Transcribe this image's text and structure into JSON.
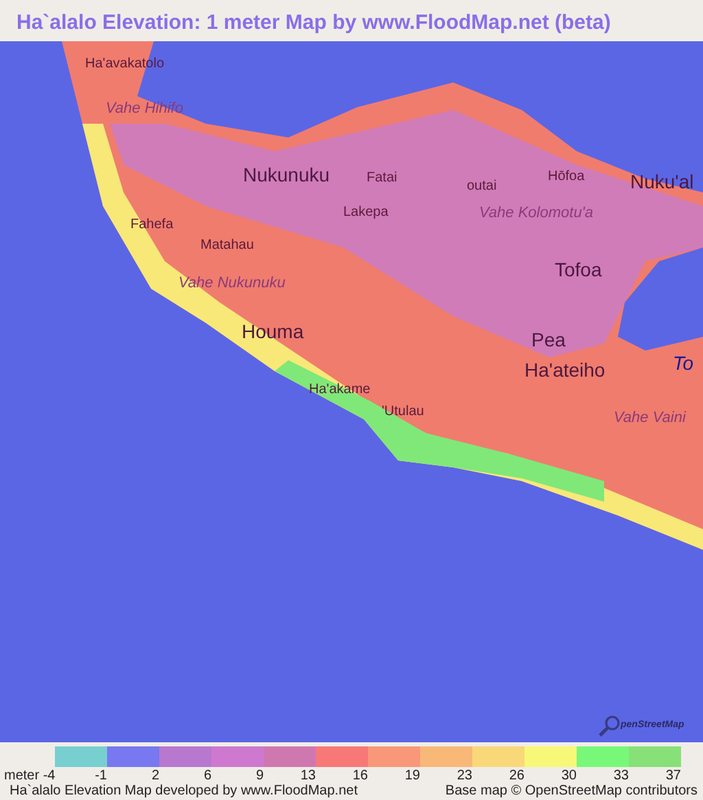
{
  "title": "Ha`alalo Elevation: 1 meter Map by www.FloodMap.net (beta)",
  "map": {
    "labels": [
      {
        "text": "Ha'avakatolo",
        "kind": "place"
      },
      {
        "text": "Vahe Hihifo",
        "kind": "district"
      },
      {
        "text": "Nukunuku",
        "kind": "town"
      },
      {
        "text": "Fatai",
        "kind": "place"
      },
      {
        "text": "outai",
        "kind": "place"
      },
      {
        "text": "Hōfoa",
        "kind": "place"
      },
      {
        "text": "Nuku'al",
        "kind": "town"
      },
      {
        "text": "Matahau",
        "kind": "place"
      },
      {
        "text": "Lakepa",
        "kind": "place"
      },
      {
        "text": "Vahe Kolomotu'a",
        "kind": "district"
      },
      {
        "text": "Fahefa",
        "kind": "place"
      },
      {
        "text": "Vahe Nukunuku",
        "kind": "district"
      },
      {
        "text": "Tofoa",
        "kind": "town"
      },
      {
        "text": "Houma",
        "kind": "town"
      },
      {
        "text": "Pea",
        "kind": "town"
      },
      {
        "text": "Ha'ateiho",
        "kind": "town"
      },
      {
        "text": "To",
        "kind": "water"
      },
      {
        "text": "Ha'akame",
        "kind": "place"
      },
      {
        "text": "'Utulau",
        "kind": "place"
      },
      {
        "text": "Vahe Vaini",
        "kind": "district"
      }
    ],
    "attribution_logo": "penStreetMap"
  },
  "legend": {
    "unit": "meter",
    "first_tick": "-4",
    "items": [
      {
        "color": "#78cfcf",
        "label": "-1"
      },
      {
        "color": "#7878f0",
        "label": "2"
      },
      {
        "color": "#b878cf",
        "label": "6"
      },
      {
        "color": "#cf78cf",
        "label": "9"
      },
      {
        "color": "#cf78b0",
        "label": "13"
      },
      {
        "color": "#f87878",
        "label": "16"
      },
      {
        "color": "#f89878",
        "label": "19"
      },
      {
        "color": "#f8b878",
        "label": "23"
      },
      {
        "color": "#f8d878",
        "label": "26"
      },
      {
        "color": "#f8f878",
        "label": "30"
      },
      {
        "color": "#78f878",
        "label": "33"
      },
      {
        "color": "#88e078",
        "label": "37"
      }
    ]
  },
  "footer": {
    "left": "Ha`alalo Elevation Map developed by www.FloodMap.net",
    "right": "Base map © OpenStreetMap contributors"
  }
}
